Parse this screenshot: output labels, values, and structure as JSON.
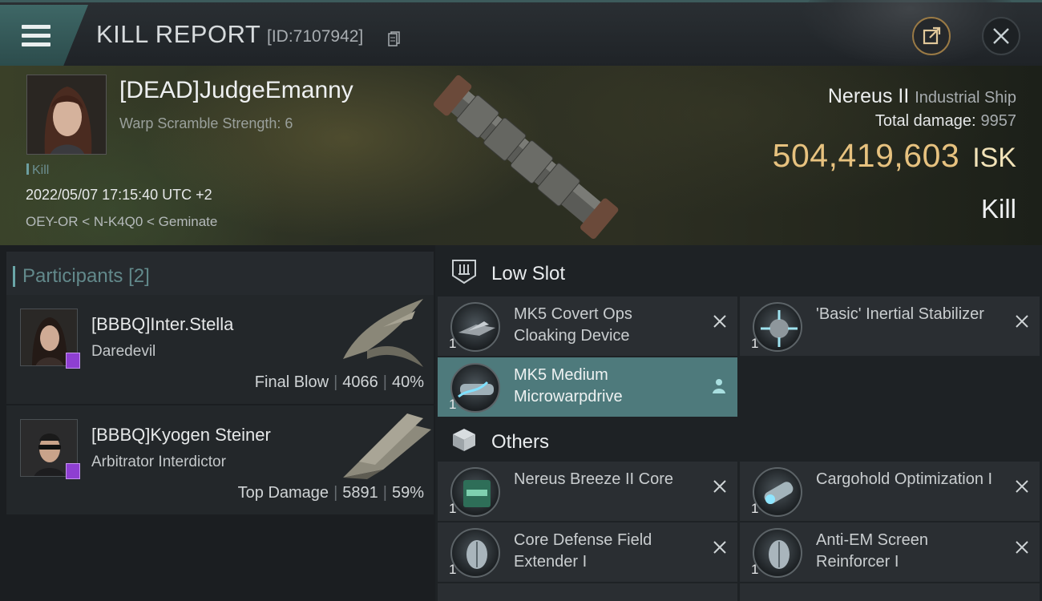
{
  "header": {
    "title": "KILL REPORT",
    "id_label": "[ID:7107942]"
  },
  "victim": {
    "name": "[DEAD]JudgeEmanny",
    "warp_scramble": "Warp Scramble Strength: 6",
    "tag": "Kill",
    "datetime": "2022/05/07 17:15:40 UTC +2",
    "location": "OEY-OR < N-K4Q0 < Geminate",
    "ship_name": "Nereus II",
    "ship_class": "Industrial Ship",
    "total_damage_label": "Total damage:",
    "total_damage": "9957",
    "isk_value": "504,419,603",
    "isk_currency": "ISK",
    "result": "Kill"
  },
  "participants": {
    "title": "Participants",
    "count": "[2]",
    "items": [
      {
        "name": "[BBBQ]Inter.Stella",
        "ship": "Daredevil",
        "role": "Final Blow",
        "damage": "4066",
        "percent": "40%"
      },
      {
        "name": "[BBBQ]Kyogen Steiner",
        "ship": "Arbitrator Interdictor",
        "role": "Top Damage",
        "damage": "5891",
        "percent": "59%"
      }
    ]
  },
  "fitting": {
    "low_slot_title": "Low Slot",
    "others_title": "Others",
    "low_slot": [
      {
        "name": "MK5 Covert Ops Cloaking Device",
        "qty": "1"
      },
      {
        "name": "'Basic' Inertial Stabilizer",
        "qty": "1"
      },
      {
        "name": "MK5 Medium Microwarpdrive",
        "qty": "1"
      }
    ],
    "others": [
      {
        "name": "Nereus Breeze II Core",
        "qty": "1"
      },
      {
        "name": "Cargohold Optimization I",
        "qty": "1"
      },
      {
        "name": "Core Defense Field Extender I",
        "qty": "1"
      },
      {
        "name": "Anti-EM Screen Reinforcer I",
        "qty": "1"
      }
    ]
  }
}
